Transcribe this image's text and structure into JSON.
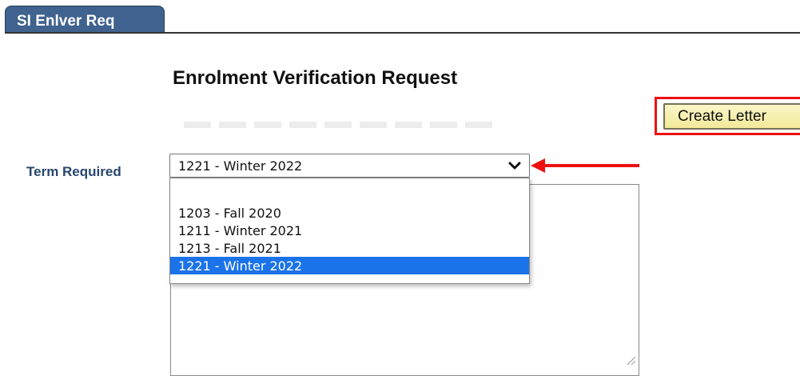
{
  "tabs": [
    {
      "label": "SI Enlver Req"
    }
  ],
  "page": {
    "title": "Enrolment Verification Request"
  },
  "actions": {
    "create_letter_label": "Create Letter"
  },
  "term_field": {
    "label": "Term Required",
    "selected_value": "1221 - Winter 2022",
    "options": [
      "",
      "1203 - Fall 2020",
      "1211 - Winter 2021",
      "1213 - Fall 2021",
      "1221 - Winter 2022"
    ],
    "highlighted_option": "1221 - Winter 2022"
  },
  "colors": {
    "tab_bg": "#3f628e",
    "label_color": "#27466e",
    "button_bg": "#f7efb0",
    "annotation_red": "#ee1111",
    "option_highlight": "#1a73e8"
  },
  "annotations": {
    "arrow_icon": "left-arrow-icon",
    "highlight_box": "red-outline"
  }
}
